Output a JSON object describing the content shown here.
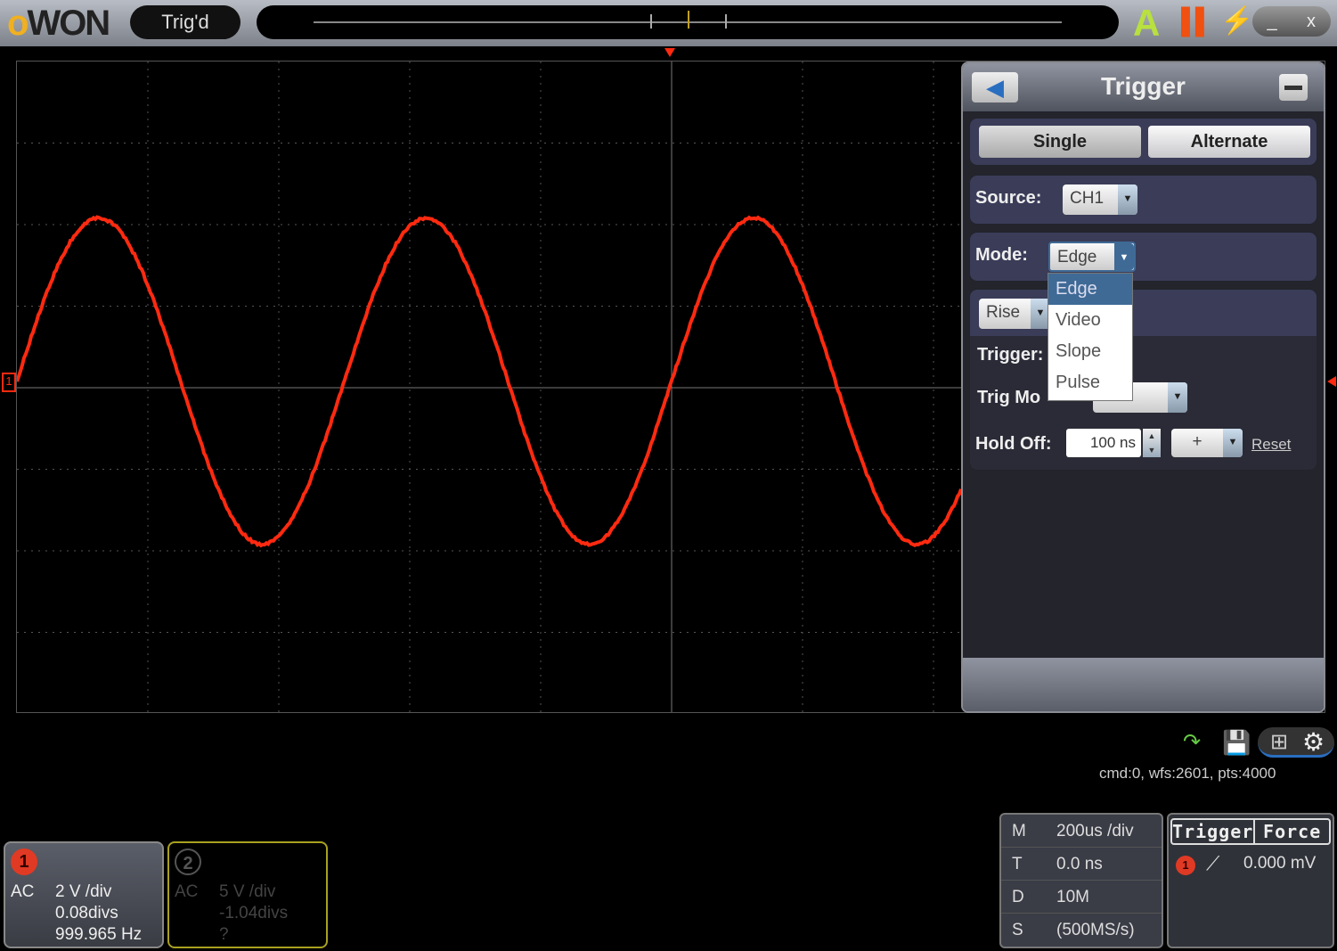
{
  "topbar": {
    "logo": "OWON",
    "status": "Trig'd",
    "auto_icon": "auto-set-icon",
    "run_icon": "pause-icon",
    "bolt_icon": "bolt-icon",
    "minimize": "_",
    "close": "x"
  },
  "colors": {
    "ch1": "#ff2a10",
    "ch2": "#a8a020",
    "accent": "#3f6a96"
  },
  "waveform": {
    "channel": "CH1",
    "frequency_hz": 999.965,
    "amplitude_divs": 2.0,
    "offset_divs": 0.08,
    "periods_per_div": 0.4
  },
  "trigger_panel": {
    "title": "Trigger",
    "back_icon": "back-arrow-icon",
    "min_icon": "minimize-icon",
    "tabs": [
      "Single",
      "Alternate"
    ],
    "source_label": "Source:",
    "source_value": "CH1",
    "mode_label": "Mode:",
    "mode_value": "Edge",
    "mode_options": [
      "Edge",
      "Video",
      "Slope",
      "Pulse"
    ],
    "slope_value": "Rise",
    "trigger_label": "Trigger:",
    "trig_mode_label": "Trig Mo",
    "holdoff_label": "Hold Off:",
    "holdoff_value": "100 ns",
    "holdoff_sign": "+",
    "reset": "Reset"
  },
  "status_line": "cmd:0, wfs:2601, pts:4000",
  "ch1": {
    "num": "1",
    "coupling": "AC",
    "scale": "2 V /div",
    "offset": "0.08divs",
    "freq": "999.965 Hz"
  },
  "ch2": {
    "num": "2",
    "coupling": "AC",
    "scale": "5 V /div",
    "offset": "-1.04divs",
    "freq": "?"
  },
  "timebase": [
    {
      "k": "M",
      "v": "200us /div"
    },
    {
      "k": "T",
      "v": "0.0 ns"
    },
    {
      "k": "D",
      "v": "10M"
    },
    {
      "k": "S",
      "v": "(500MS/s)"
    }
  ],
  "trigger_info": {
    "buttons": [
      "Trigger",
      "Force"
    ],
    "level": "0.000 mV",
    "channel": "1"
  }
}
